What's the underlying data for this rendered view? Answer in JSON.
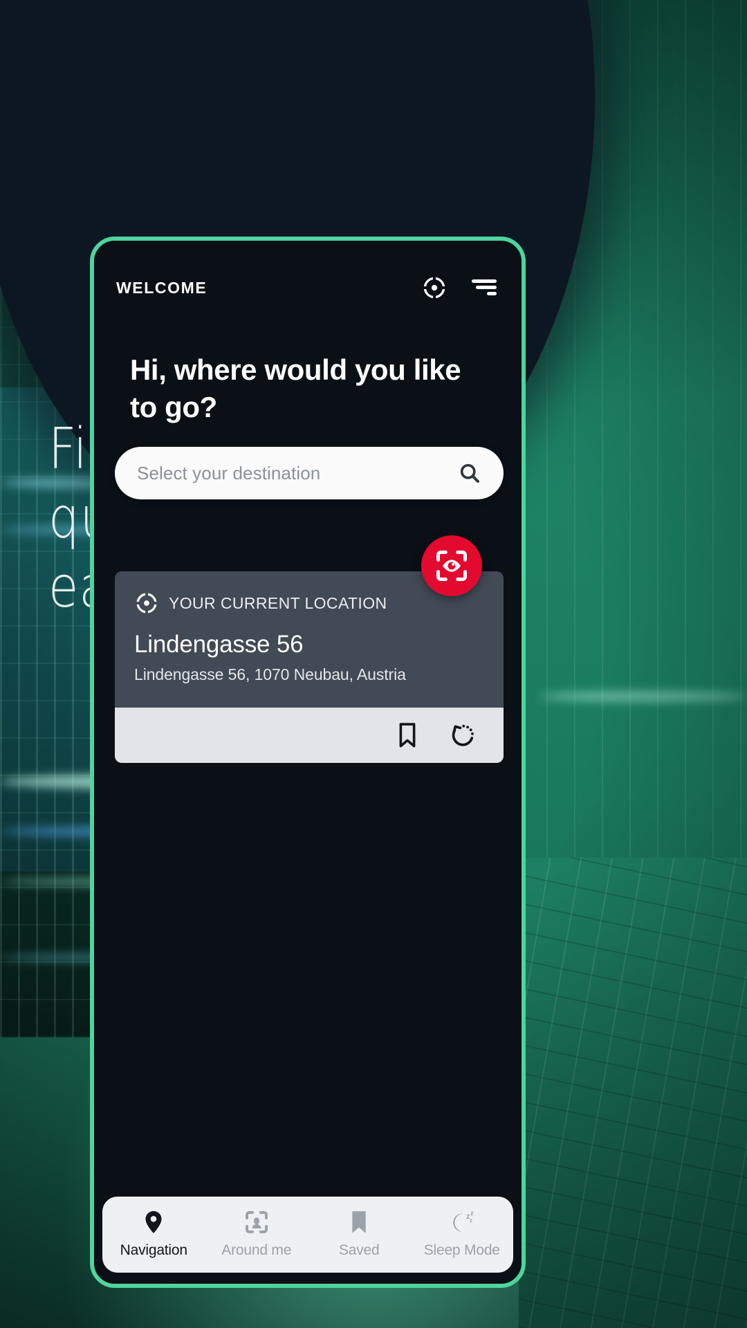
{
  "hero": {
    "headline_line1": "Find your way",
    "headline_line2": "quickly and easily..."
  },
  "colors": {
    "accent_green": "#4ed49c",
    "ar_red": "#e4092f",
    "card_slate": "#424a56",
    "screen_dark": "#0b1017",
    "hero_navy": "#0d1722"
  },
  "phone": {
    "header": {
      "title": "WELCOME",
      "locate_icon": "crosshair-target-icon",
      "menu_icon": "hamburger-menu-icon"
    },
    "greeting": "Hi, where would you like to go?",
    "search": {
      "placeholder": "Select your destination",
      "value": "",
      "icon": "search-icon"
    },
    "ar_button": {
      "icon": "eye-scan-icon",
      "label": "AR view"
    },
    "location_card": {
      "icon": "crosshair-target-icon",
      "label": "YOUR CURRENT LOCATION",
      "title": "Lindengasse 56",
      "address": "Lindengasse 56, 1070 Neubau, Austria",
      "actions": [
        {
          "name": "bookmark-icon",
          "label": "Save"
        },
        {
          "name": "refresh-icon",
          "label": "Refresh"
        }
      ]
    },
    "bottom_nav": {
      "items": [
        {
          "label": "Navigation",
          "icon": "map-pin-icon",
          "active": true
        },
        {
          "label": "Around me",
          "icon": "person-scan-icon",
          "active": false
        },
        {
          "label": "Saved",
          "icon": "bookmark-icon",
          "active": false
        },
        {
          "label": "Sleep Mode",
          "icon": "moon-zzz-icon",
          "active": false
        }
      ]
    }
  }
}
